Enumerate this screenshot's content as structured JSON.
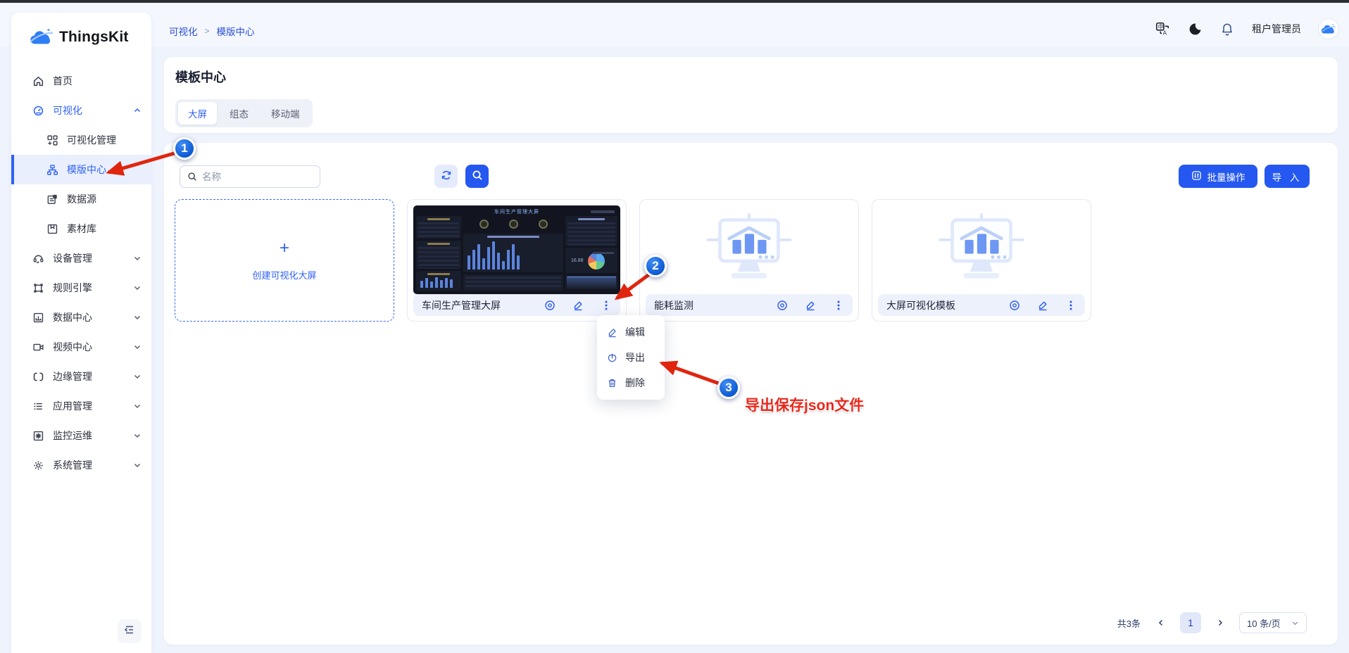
{
  "app": {
    "name": "ThingsKit"
  },
  "topbar": {
    "breadcrumbs": [
      "可视化",
      "模版中心"
    ],
    "separator": ">",
    "icons": [
      "translate-icon",
      "dark-mode-icon",
      "notification-icon"
    ],
    "user_name": "租户管理员"
  },
  "sidebar": {
    "items": [
      {
        "label": "首页",
        "icon": "home-icon"
      },
      {
        "label": "可视化",
        "icon": "visualization-icon",
        "expanded": true,
        "active": true
      },
      {
        "label": "可视化管理",
        "icon": "visualization-manage-icon",
        "level": 2
      },
      {
        "label": "模版中心",
        "icon": "template-center-icon",
        "level": 2,
        "selected": true
      },
      {
        "label": "数据源",
        "icon": "datasource-icon",
        "level": 2
      },
      {
        "label": "素材库",
        "icon": "material-library-icon",
        "level": 2
      },
      {
        "label": "设备管理",
        "icon": "device-manage-icon",
        "collapsible": true
      },
      {
        "label": "规则引擎",
        "icon": "rule-engine-icon",
        "collapsible": true
      },
      {
        "label": "数据中心",
        "icon": "data-center-icon",
        "collapsible": true
      },
      {
        "label": "视频中心",
        "icon": "video-center-icon",
        "collapsible": true
      },
      {
        "label": "边缘管理",
        "icon": "edge-manage-icon",
        "collapsible": true
      },
      {
        "label": "应用管理",
        "icon": "app-manage-icon",
        "collapsible": true
      },
      {
        "label": "监控运维",
        "icon": "monitor-ops-icon",
        "collapsible": true
      },
      {
        "label": "系统管理",
        "icon": "system-manage-icon",
        "collapsible": true
      }
    ]
  },
  "page": {
    "title": "模板中心",
    "tabs": [
      {
        "label": "大屏",
        "active": true
      },
      {
        "label": "组态",
        "active": false
      },
      {
        "label": "移动端",
        "active": false
      }
    ]
  },
  "toolbar": {
    "search_placeholder": "名称",
    "batch_label": "批量操作",
    "import_label": "导 入"
  },
  "cards": {
    "create_label": "创建可视化大屏",
    "items": [
      {
        "title": "车间生产管理大屏",
        "thumb": "dashboard-screenshot",
        "thumb_title": "车间生产管理大屏",
        "thumb_stat": "16.88"
      },
      {
        "title": "能耗监测",
        "thumb": "placeholder-monitor"
      },
      {
        "title": "大屏可视化模板",
        "thumb": "placeholder-monitor"
      }
    ]
  },
  "context_menu": {
    "items": [
      {
        "label": "编辑",
        "icon": "edit-icon"
      },
      {
        "label": "导出",
        "icon": "export-icon"
      },
      {
        "label": "删除",
        "icon": "delete-icon"
      }
    ]
  },
  "annotations": {
    "steps": [
      "1",
      "2",
      "3"
    ],
    "note": "导出保存json文件",
    "color": "#e0250f"
  },
  "pagination": {
    "total": "共3条",
    "current_page": "1",
    "page_size": "10 条/页"
  },
  "colors": {
    "accent": "#2558f0",
    "sidebar_active": "#2f62f5",
    "annotation_red": "#e0250f"
  }
}
